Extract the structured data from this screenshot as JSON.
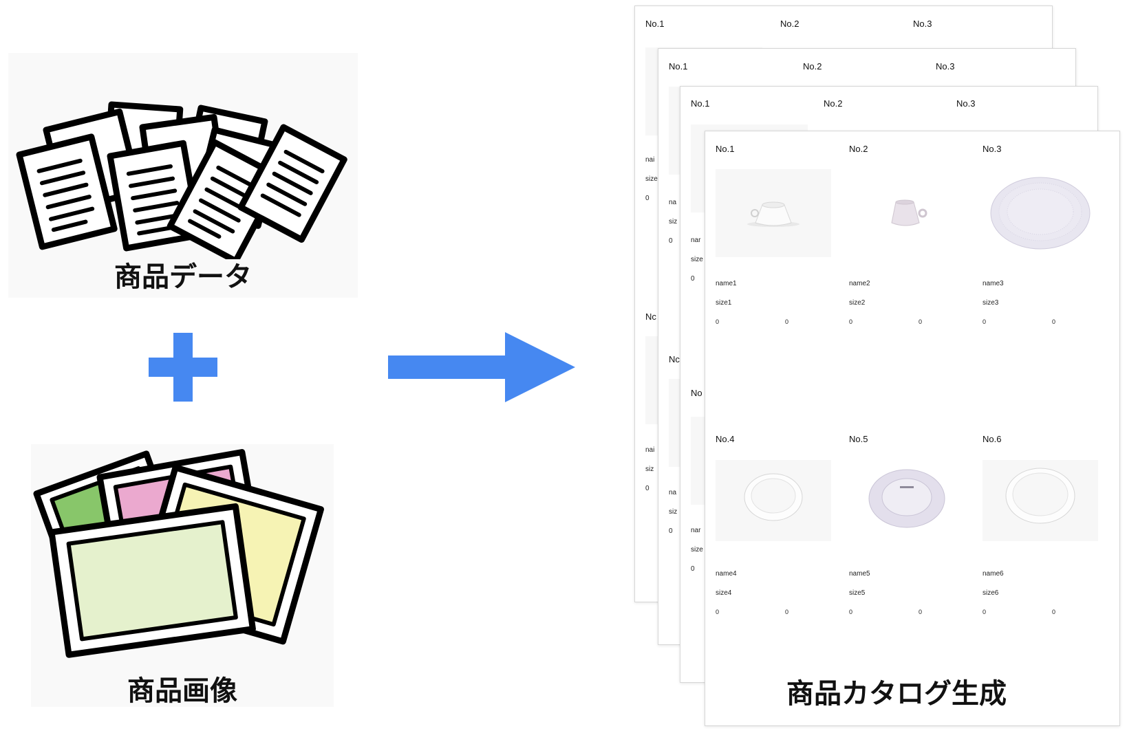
{
  "inputs": {
    "data_label": "商品データ",
    "image_label": "商品画像"
  },
  "output": {
    "title": "商品カタログ生成"
  },
  "back_pages": [
    {
      "headers": [
        "No.1",
        "No.2",
        "No.3"
      ]
    },
    {
      "headers": [
        "No.1",
        "No.2",
        "No.3"
      ]
    },
    {
      "headers": [
        "No.1",
        "No.2",
        "No.3"
      ]
    }
  ],
  "front_page": {
    "items": [
      {
        "no": "No.1",
        "name": "name1",
        "size": "size1",
        "val_a": "0",
        "val_b": "0",
        "kind": "cup"
      },
      {
        "no": "No.2",
        "name": "name2",
        "size": "size2",
        "val_a": "0",
        "val_b": "0",
        "kind": "cup-small"
      },
      {
        "no": "No.3",
        "name": "name3",
        "size": "size3",
        "val_a": "0",
        "val_b": "0",
        "kind": "plate-ribbed"
      },
      {
        "no": "No.4",
        "name": "name4",
        "size": "size4",
        "val_a": "0",
        "val_b": "0",
        "kind": "plate"
      },
      {
        "no": "No.5",
        "name": "name5",
        "size": "size5",
        "val_a": "0",
        "val_b": "0",
        "kind": "plate-back"
      },
      {
        "no": "No.6",
        "name": "name6",
        "size": "size6",
        "val_a": "0",
        "val_b": "0",
        "kind": "plate"
      }
    ]
  },
  "partial_labels": {
    "p1": {
      "na": "nai",
      "si": "size",
      "zero": "0",
      "no": "Nc",
      "na2": "nai",
      "si2": "siz",
      "zero2": "0"
    },
    "p2": {
      "na": "na",
      "si": "siz",
      "zero": "0",
      "no": "Nc",
      "na2": "na",
      "si2": "siz",
      "zero2": "0"
    },
    "p3": {
      "na": "nar",
      "si": "size",
      "zero": "0",
      "no": "No",
      "na2": "nar",
      "si2": "size",
      "zero2": "0"
    }
  },
  "colors": {
    "accent": "#4688f1",
    "green": "#88c66a",
    "pink": "#eba9cf",
    "yellow": "#f6f3b4",
    "lightgreen": "#e5f1cd"
  }
}
